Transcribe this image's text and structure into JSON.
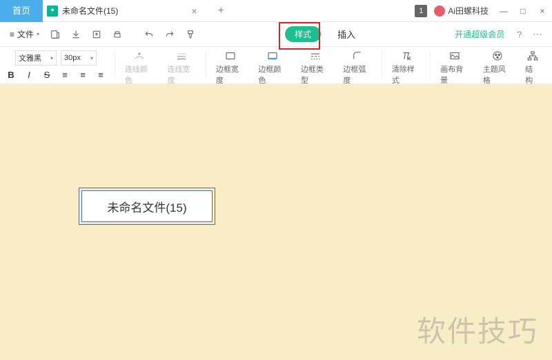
{
  "titlebar": {
    "home_tab": "首页",
    "file_tab": "未命名文件(15)",
    "file_tab_close": "×",
    "add_tab": "+",
    "badge": "1",
    "user_name": "Ai田螺科技",
    "win_min": "—",
    "win_max": "□",
    "win_close": "×"
  },
  "menubar": {
    "file_label": "文件",
    "style_tab": "样式",
    "insert_tab": "插入",
    "member_label": "开通超级会员",
    "help": "?",
    "more": "⋯"
  },
  "toolbar": {
    "font_name": "文雅黑",
    "font_size": "30px",
    "bold": "B",
    "italic": "I",
    "strike": "S",
    "align1": "≡",
    "align2": "≡",
    "align3": "≡",
    "line_color": "连线颜色",
    "line_width": "连线宽度",
    "border_width": "边框宽度",
    "border_color": "边框颜色",
    "border_type": "边框类型",
    "border_radius": "边框弧度",
    "clear_style": "清除样式",
    "canvas_bg": "画布背景",
    "theme_style": "主题风格",
    "structure": "结构"
  },
  "canvas": {
    "node_text": "未命名文件(15)",
    "watermark": "软件技巧"
  }
}
